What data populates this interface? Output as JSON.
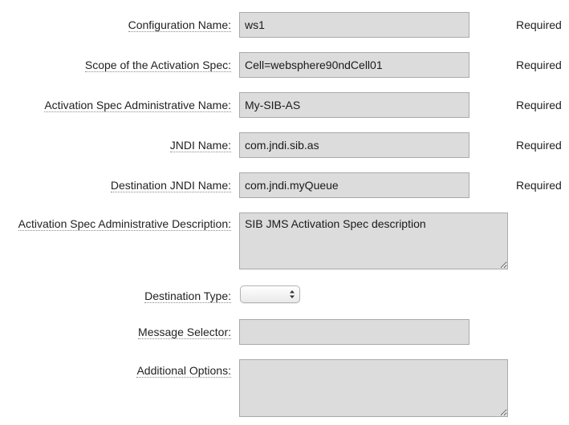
{
  "fields": {
    "configuration_name": {
      "label": "Configuration Name:",
      "value": "ws1",
      "required": "Required"
    },
    "scope": {
      "label": "Scope of the Activation Spec:",
      "value": "Cell=websphere90ndCell01",
      "required": "Required"
    },
    "admin_name": {
      "label": "Activation Spec Administrative Name:",
      "value": "My-SIB-AS",
      "required": "Required"
    },
    "jndi_name": {
      "label": "JNDI Name:",
      "value": "com.jndi.sib.as",
      "required": "Required"
    },
    "destination_jndi": {
      "label": "Destination JNDI Name:",
      "value": "com.jndi.myQueue",
      "required": "Required"
    },
    "admin_description": {
      "label": "Activation Spec Administrative Description:",
      "value": "SIB JMS Activation Spec description"
    },
    "destination_type": {
      "label": "Destination Type:",
      "value": ""
    },
    "message_selector": {
      "label": "Message Selector:",
      "value": ""
    },
    "additional_options": {
      "label": "Additional Options:",
      "value": ""
    }
  },
  "icons": {
    "select_arrows": "updown-chevron-icon",
    "resize": "resize-grip-icon"
  },
  "colors": {
    "field_bg": "#dcdcdc",
    "field_border": "#a9a9a9",
    "text": "#222222"
  }
}
